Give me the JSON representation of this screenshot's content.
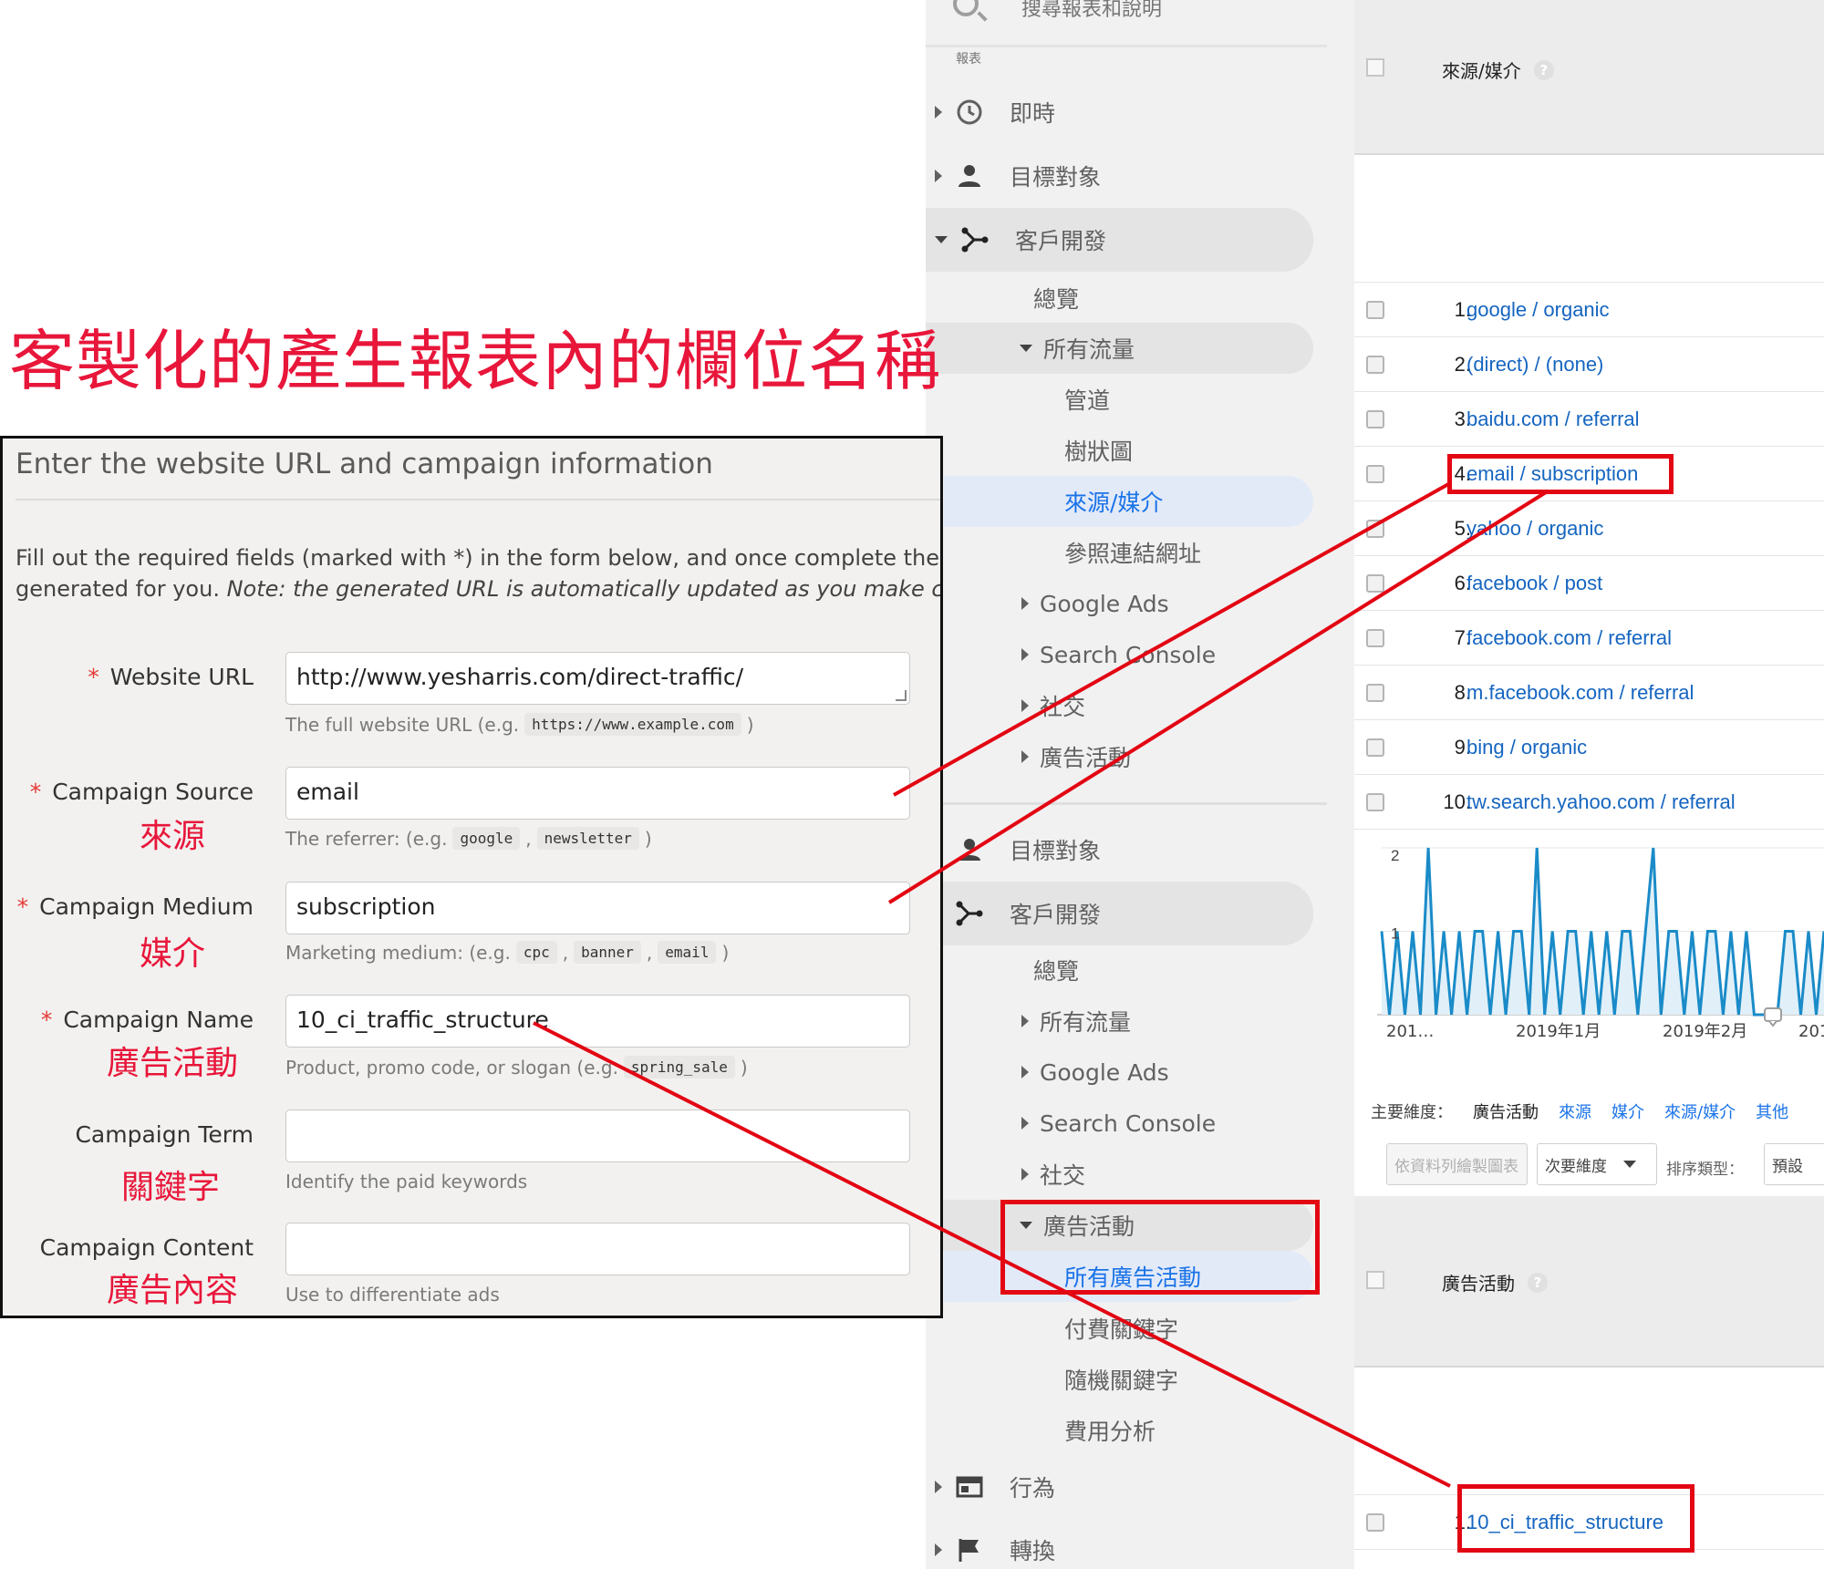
{
  "headline": "客製化的產生報表內的欄位名稱",
  "nav": {
    "search_placeholder": "搜尋報表和說明",
    "reports_label": "報表",
    "items_top": {
      "realtime": "即時",
      "audience": "目標對象",
      "acquisition": "客戶開發",
      "overview": "總覽",
      "all_traffic": "所有流量",
      "channels": "管道",
      "treemaps": "樹狀圖",
      "source_medium": "來源/媒介",
      "referrals": "參照連結網址",
      "google_ads": "Google Ads",
      "search_console": "Search Console",
      "social": "社交",
      "campaigns": "廣告活動"
    },
    "items_bottom": {
      "audience": "目標對象",
      "acquisition": "客戶開發",
      "overview": "總覽",
      "all_traffic": "所有流量",
      "google_ads": "Google Ads",
      "search_console": "Search Console",
      "social": "社交",
      "campaigns": "廣告活動",
      "all_campaigns": "所有廣告活動",
      "paid_keywords": "付費關鍵字",
      "organic_keywords": "隨機關鍵字",
      "cost_analysis": "費用分析",
      "behavior": "行為",
      "conversions": "轉換"
    }
  },
  "table_top": {
    "header": "來源/媒介",
    "rows": [
      {
        "num": "1.",
        "value": "google / organic"
      },
      {
        "num": "2.",
        "value": "(direct) / (none)"
      },
      {
        "num": "3.",
        "value": "baidu.com / referral"
      },
      {
        "num": "4.",
        "value": "email / subscription"
      },
      {
        "num": "5.",
        "value": "yahoo / organic"
      },
      {
        "num": "6.",
        "value": "facebook / post"
      },
      {
        "num": "7.",
        "value": "facebook.com / referral"
      },
      {
        "num": "8.",
        "value": "m.facebook.com / referral"
      },
      {
        "num": "9.",
        "value": "bing / organic"
      },
      {
        "num": "10.",
        "value": "tw.search.yahoo.com / referral"
      }
    ]
  },
  "chart": {
    "x_labels": [
      "201…",
      "2019年1月",
      "2019年2月",
      "201"
    ],
    "y_labels": [
      "2",
      "1"
    ],
    "line_color": "#1a8bc8",
    "fill_color": "#e1f0f8"
  },
  "chart_data": {
    "type": "area",
    "ylim": [
      0,
      2
    ],
    "x": [
      "201…",
      "2019年1月",
      "2019年2月",
      "201"
    ],
    "values": [
      1,
      0,
      1,
      0,
      1,
      0,
      2,
      0,
      1,
      0,
      1,
      0,
      1,
      1,
      0,
      1,
      0,
      1,
      1,
      0,
      2,
      0,
      1,
      0,
      1,
      1,
      0,
      1,
      0,
      1,
      0,
      1,
      1,
      0,
      1,
      2,
      0,
      1,
      1,
      0,
      1,
      0,
      1,
      1,
      0,
      1,
      0,
      1,
      0,
      0,
      0,
      0,
      1,
      1,
      0,
      1,
      0,
      1
    ]
  },
  "dimensions": {
    "label": "主要維度：",
    "selected": "廣告活動",
    "links": [
      "來源",
      "媒介",
      "來源/媒介",
      "其他"
    ]
  },
  "toolbar": {
    "plot_rows": "依資料列繪製圖表",
    "secondary_dim": "次要維度",
    "sort_label": "排序類型：",
    "default": "預設"
  },
  "table_bottom": {
    "header": "廣告活動",
    "rows": [
      {
        "num": "1.",
        "value": "10_ci_traffic_structure"
      }
    ]
  },
  "form": {
    "title": "Enter the website URL and campaign information",
    "desc_line1": "Fill out the required fields (marked with *) in the form below, and once complete the full c",
    "desc_line2_plain": "generated for you. ",
    "desc_line2_italic": "Note: the generated URL is automatically updated as you make chang",
    "fields": {
      "website_url": {
        "label": "Website URL",
        "value": "http://www.yesharris.com/direct-traffic/",
        "help": "The full website URL (e.g.",
        "codes": [
          "https://www.example.com"
        ]
      },
      "source": {
        "label": "Campaign Source",
        "cn": "來源",
        "value": "email",
        "help": "The referrer: (e.g.",
        "codes": [
          "google",
          "newsletter"
        ]
      },
      "medium": {
        "label": "Campaign Medium",
        "cn": "媒介",
        "value": "subscription",
        "help": "Marketing medium: (e.g.",
        "codes": [
          "cpc",
          "banner",
          "email"
        ]
      },
      "name": {
        "label": "Campaign Name",
        "cn": "廣告活動",
        "value": "10_ci_traffic_structure",
        "help": "Product, promo code, or slogan (e.g.",
        "codes": [
          "spring_sale"
        ]
      },
      "term": {
        "label": "Campaign Term",
        "cn": "關鍵字",
        "value": "",
        "help": "Identify the paid keywords"
      },
      "content": {
        "label": "Campaign Content",
        "cn": "廣告內容",
        "value": "",
        "help": "Use to differentiate ads"
      }
    }
  },
  "colors": {
    "annotation_red": "#e30613",
    "headline_red": "#e8163a",
    "link_blue": "#1565c0"
  }
}
